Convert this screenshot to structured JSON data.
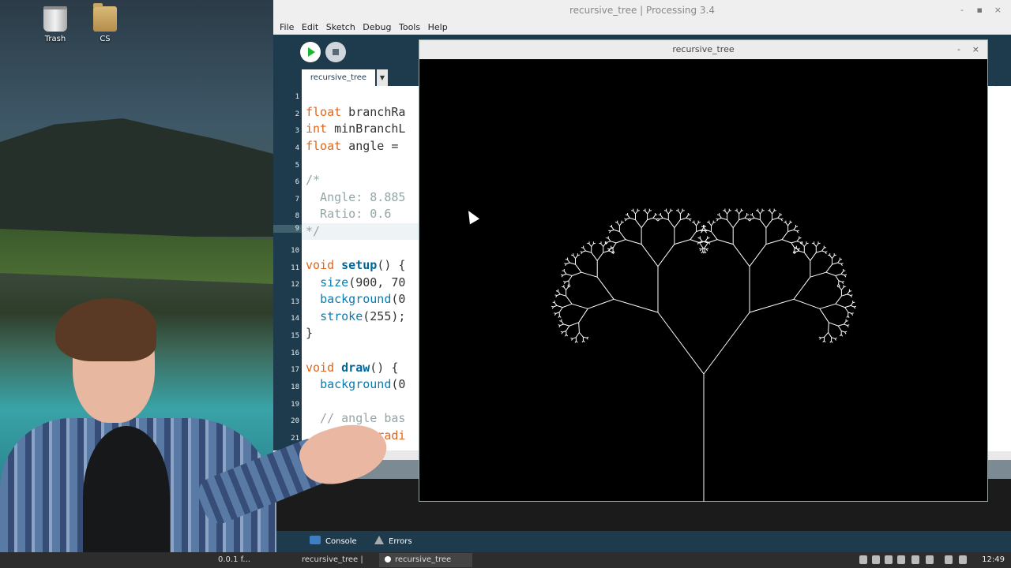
{
  "desktop": {
    "icons": [
      {
        "label": "Trash",
        "icon": "trash-icon"
      },
      {
        "label": "CS",
        "icon": "folder-icon"
      }
    ]
  },
  "ide": {
    "title": "recursive_tree | Processing 3.4",
    "window_controls": [
      "-",
      "▪",
      "×"
    ],
    "menu": [
      "File",
      "Edit",
      "Sketch",
      "Debug",
      "Tools",
      "Help"
    ],
    "tab_name": "recursive_tree",
    "tab_menu": "▼",
    "line_numbers": [
      "1",
      "2",
      "3",
      "4",
      "5",
      "6",
      "7",
      "8",
      "9",
      "10",
      "11",
      "12",
      "13",
      "14",
      "15",
      "16",
      "17",
      "18",
      "19",
      "20",
      "21"
    ],
    "console_tab": "Console",
    "errors_tab": "Errors"
  },
  "sketch_window": {
    "title": "recursive_tree",
    "controls": [
      "-",
      "×"
    ]
  },
  "taskbar": {
    "items": [
      {
        "label": "0.0.1 f..."
      },
      {
        "label": "recursive_tree | Pr..."
      },
      {
        "label": "recursive_tree"
      }
    ],
    "clock": "12:49"
  },
  "colors": {
    "ide_background": "#1e3a4d",
    "keyword": "#e2661a",
    "function": "#006699",
    "builtin": "#669900",
    "comment": "#95a5a6",
    "run_green": "#18b830"
  }
}
